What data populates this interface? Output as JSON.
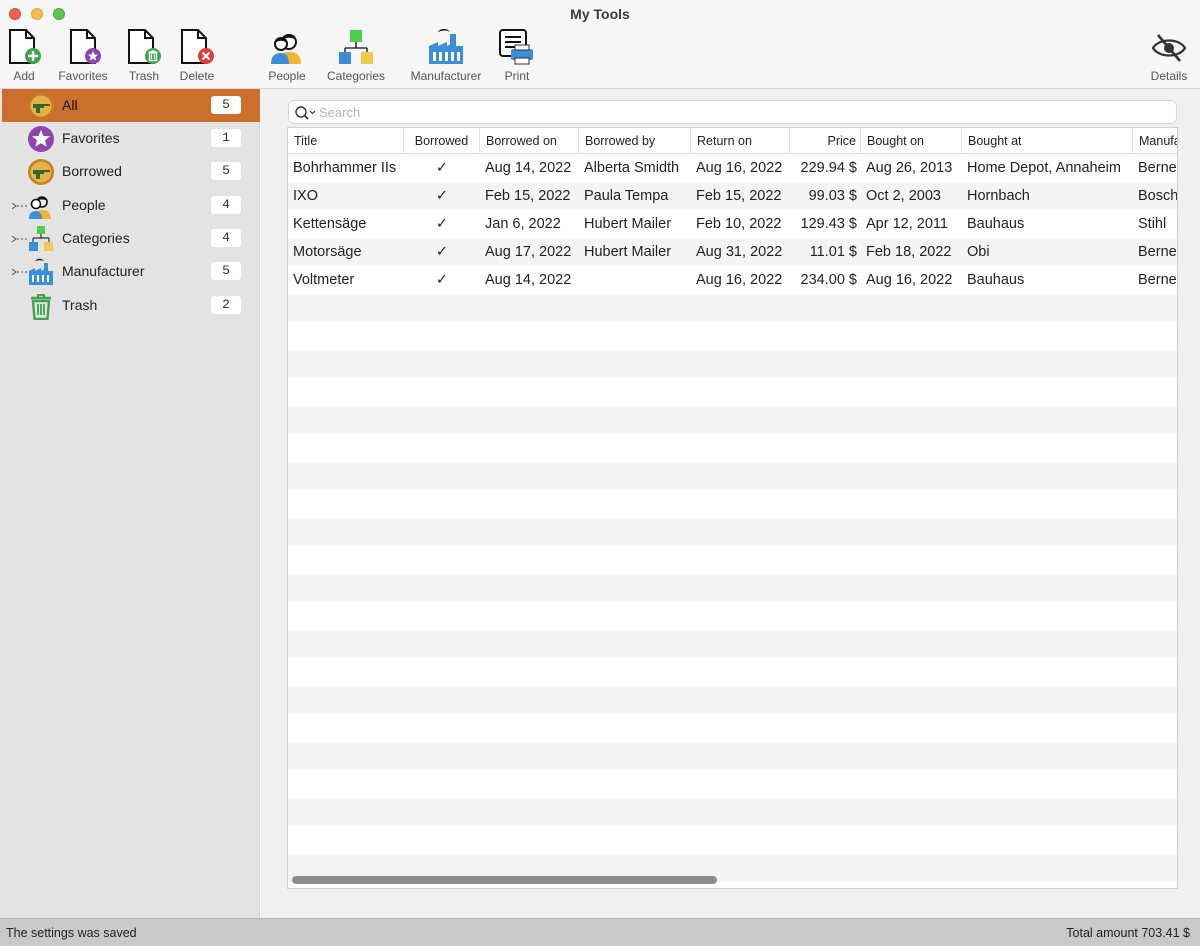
{
  "window": {
    "title": "My Tools"
  },
  "toolbar": {
    "add": "Add",
    "favorites": "Favorites",
    "trash": "Trash",
    "delete": "Delete",
    "people": "People",
    "categories": "Categories",
    "manufacturer": "Manufacturer",
    "print": "Print",
    "details": "Details"
  },
  "sidebar": {
    "items": [
      {
        "label": "All",
        "count": "5",
        "icon": "drill-icon",
        "selected": true
      },
      {
        "label": "Favorites",
        "count": "1",
        "icon": "star-icon"
      },
      {
        "label": "Borrowed",
        "count": "5",
        "icon": "drill-icon"
      },
      {
        "label": "People",
        "count": "4",
        "icon": "people-icon"
      },
      {
        "label": "Categories",
        "count": "4",
        "icon": "categories-icon"
      },
      {
        "label": "Manufacturer",
        "count": "5",
        "icon": "factory-icon"
      },
      {
        "label": "Trash",
        "count": "2",
        "icon": "trash-icon"
      }
    ]
  },
  "search": {
    "placeholder": "Search",
    "value": ""
  },
  "table": {
    "columns": [
      "Title",
      "Borrowed",
      "Borrowed on",
      "Borrowed by",
      "Return on",
      "Price",
      "Bought on",
      "Bought at",
      "Manufa"
    ],
    "rows": [
      [
        "Bohrhammer IIs",
        "✓",
        "Aug 14, 2022",
        "Alberta Smidth",
        "Aug 16, 2022",
        "229.94 $",
        "Aug 26, 2013",
        "Home Depot, Annaheim",
        "Berne"
      ],
      [
        "IXO",
        "✓",
        "Feb 15, 2022",
        "Paula Tempa",
        "Feb 15, 2022",
        "99.03 $",
        "Oct 2, 2003",
        "Hornbach",
        "Bosch"
      ],
      [
        "Kettensäge",
        "✓",
        "Jan 6, 2022",
        "Hubert Mailer",
        "Feb 10, 2022",
        "129.43 $",
        "Apr 12, 2011",
        "Bauhaus",
        "Stihl"
      ],
      [
        "Motorsäge",
        "✓",
        "Aug 17, 2022",
        "Hubert Mailer",
        "Aug 31, 2022",
        "11.01 $",
        "Feb 18, 2022",
        "Obi",
        "Berne"
      ],
      [
        "Voltmeter",
        "✓",
        "Aug 14, 2022",
        "",
        "Aug 16, 2022",
        "234.00 $",
        "Aug 16, 2022",
        "Bauhaus",
        "Berne"
      ]
    ]
  },
  "status": {
    "message": "The settings was saved",
    "total": "Total amount 703.41 $"
  },
  "colors": {
    "selection": "#cc6f2e",
    "sidebar_bg": "#e3e3e3",
    "status_bg": "#c9c9c9"
  }
}
